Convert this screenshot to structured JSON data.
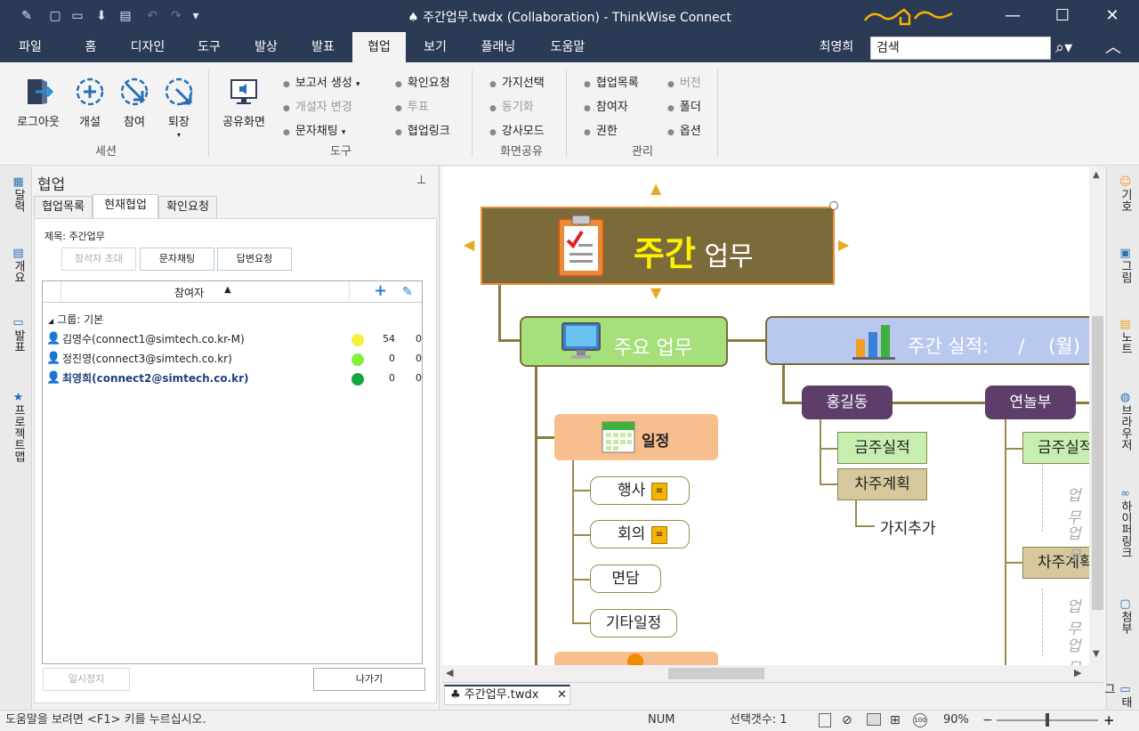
{
  "window": {
    "title": "♠ 주간업무.twdx (Collaboration)  -  ThinkWise Connect",
    "minimize": "—",
    "maximize": "☐",
    "close": "✕"
  },
  "ribbon_tabs": [
    "파일",
    "홈",
    "디자인",
    "도구",
    "발상",
    "발표",
    "협업",
    "보기",
    "플래닝",
    "도움말"
  ],
  "active_tab": "협업",
  "user_name": "최영희",
  "search": {
    "value": "검색"
  },
  "ribbon": {
    "session": {
      "group": "세션",
      "logout": "로그아웃",
      "open": "개설",
      "join": "참여",
      "leave": "퇴장"
    },
    "tools": {
      "group": "도구",
      "share_screen": "공유화면",
      "report": "보고서 생성",
      "change_owner": "개설자 변경",
      "chat": "문자채팅",
      "confirm_request": "확인요청",
      "vote": "투표",
      "collab_link": "협업링크"
    },
    "screen_share": {
      "group": "화면공유",
      "branch_select": "가지선택",
      "sync": "동기화",
      "presenter": "강사모드"
    },
    "manage": {
      "group": "관리",
      "collab_list": "협업목록",
      "participants": "참여자",
      "rights": "권한",
      "version": "버전",
      "folder": "폴더",
      "options": "옵션"
    }
  },
  "left_sidebar": [
    "달력",
    "개요",
    "발표",
    "프로젝트맵"
  ],
  "panel": {
    "title": "협업",
    "tabs": [
      "협업목록",
      "현재협업",
      "확인요청"
    ],
    "active_tab": "현재협업",
    "subject": "제목: 주간업무",
    "buttons": {
      "invite": "참석자 초대",
      "chat": "문자채팅",
      "answer_request": "답변요청"
    },
    "table_header": "참여자",
    "group_label": "그룹: 기본",
    "participants": [
      {
        "name": "김영수(connect1@simtech.co.kr-M)",
        "color": "#f5f03a",
        "count": "54",
        "count2": "0"
      },
      {
        "name": "정진영(connect3@simtech.co.kr)",
        "color": "#7ff23a",
        "count": "0",
        "count2": "0"
      },
      {
        "name": "최영희(connect2@simtech.co.kr)",
        "color": "#13a83e",
        "count": "0",
        "count2": "0"
      }
    ],
    "pause": "일시정지",
    "exit": "나가기"
  },
  "map": {
    "root": {
      "bold": "주간",
      "rest": " 업무"
    },
    "main_task": "주요 업무",
    "weekly_result": "주간 실적:     /    (월)",
    "schedule": "일정",
    "events": [
      "행사",
      "회의",
      "면담",
      "기타일정"
    ],
    "person1": "홍길동",
    "person2": "연놀부",
    "this_week": "금주실적",
    "next_week": "차주계획",
    "add_branch": "가지추가",
    "this_week2": "금주실적",
    "next_week2": "차주계획",
    "placeholder": "업무"
  },
  "right_sidebar": [
    "기호",
    "그림",
    "노트",
    "브라우저",
    "하이퍼링크",
    "첨부",
    "태그"
  ],
  "doc_tab": "주간업무.twdx",
  "status": {
    "help": "도움말을 보려면 <F1> 키를 누르십시오.",
    "num": "NUM",
    "selection": "선택갯수: 1",
    "zoom": "90%"
  },
  "colors": {
    "titlebar": "#2b3a55",
    "root_fill": "#7c6b3a",
    "root_text": "#fff200",
    "main_green": "#a5e07a",
    "blue_node": "#b9c8ef",
    "person": "#5d3e6b",
    "schedule": "#f7bf8e"
  }
}
